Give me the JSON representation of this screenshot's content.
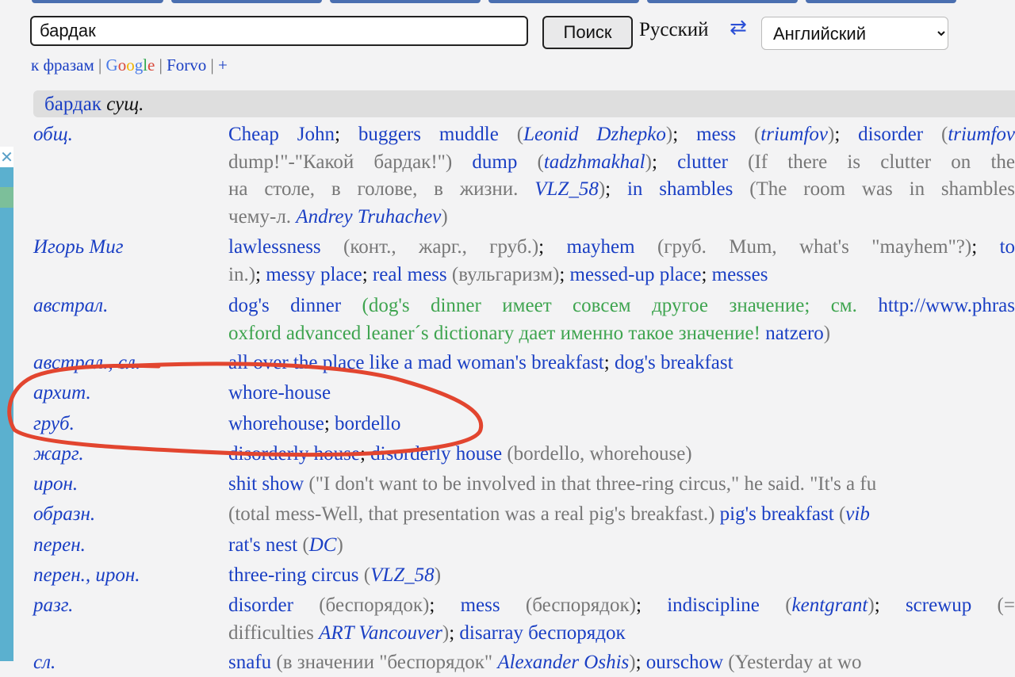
{
  "search": {
    "value": "бардак",
    "button": "Поиск"
  },
  "lang": {
    "source": "Русский",
    "swap_icon": "⇄",
    "target": "Английский",
    "swap_icon_name": "swap-arrows-icon"
  },
  "links": {
    "phrases": "к фразам",
    "google": [
      "G",
      "o",
      "o",
      "g",
      "l",
      "e"
    ],
    "forvo": "Forvo",
    "plus": "+",
    "sep": "|"
  },
  "headword": {
    "word": "бардак",
    "pos": "сущ."
  },
  "colors": {
    "link": "#1a3fc4",
    "annotation": "#e2452f",
    "muted": "#666666",
    "note_green": "#3ea44f"
  },
  "entries": [
    {
      "cat": "общ.",
      "lines": [
        [
          [
            "b",
            "Cheap John"
          ],
          [
            "k",
            "; "
          ],
          [
            "b",
            "buggers muddle"
          ],
          [
            "g",
            " ("
          ],
          [
            "bi",
            "Leonid Dzhepko"
          ],
          [
            "g",
            ")"
          ],
          [
            "k",
            "; "
          ],
          [
            "b",
            "mess"
          ],
          [
            "g",
            " ("
          ],
          [
            "bi",
            "triumfov"
          ],
          [
            "g",
            ")"
          ],
          [
            "k",
            "; "
          ],
          [
            "b",
            "disorder"
          ],
          [
            "g",
            " ("
          ],
          [
            "bi",
            "triumfov"
          ]
        ],
        [
          [
            "g",
            "dump!\"-\"Какой бардак!\")"
          ],
          [
            "k",
            " "
          ],
          [
            "b",
            "dump"
          ],
          [
            "g",
            " ("
          ],
          [
            "bi",
            "tadzhmakhal"
          ],
          [
            "g",
            ")"
          ],
          [
            "k",
            "; "
          ],
          [
            "b",
            "clutter"
          ],
          [
            "g",
            " (If there is clutter on the"
          ]
        ],
        [
          [
            "g",
            "на столе, в голове, в жизни. "
          ],
          [
            "bi",
            "VLZ_58"
          ],
          [
            "g",
            ")"
          ],
          [
            "k",
            "; "
          ],
          [
            "b",
            "in shambles"
          ],
          [
            "g",
            " (The room was in shambles"
          ]
        ],
        [
          [
            "g",
            "чему-л. "
          ],
          [
            "bi",
            "Andrey Truhachev"
          ],
          [
            "g",
            ")"
          ]
        ]
      ]
    },
    {
      "cat": "Игорь Миг",
      "lines": [
        [
          [
            "b",
            "lawlessness"
          ],
          [
            "g",
            " (конт., жарг., груб.)"
          ],
          [
            "k",
            "; "
          ],
          [
            "b",
            "mayhem"
          ],
          [
            "g",
            " (груб. Mum, what's \"mayhem\"?)"
          ],
          [
            "k",
            "; "
          ],
          [
            "b",
            "to"
          ]
        ],
        [
          [
            "g",
            "in.)"
          ],
          [
            "k",
            "; "
          ],
          [
            "b",
            "messy place"
          ],
          [
            "k",
            "; "
          ],
          [
            "b",
            "real mess"
          ],
          [
            "g",
            " (вульгаризм)"
          ],
          [
            "k",
            "; "
          ],
          [
            "b",
            "messed-up place"
          ],
          [
            "k",
            "; "
          ],
          [
            "b",
            "messes"
          ]
        ]
      ]
    },
    {
      "cat": "австрал.",
      "lines": [
        [
          [
            "b",
            "dog's dinner"
          ],
          [
            "gr",
            " (dog's dinner имеет совсем другое значение; см. "
          ],
          [
            "b",
            "http://www.phras"
          ]
        ],
        [
          [
            "gr",
            "oxford advanced leaner´s dictionary дает именно такое значение! "
          ],
          [
            "b",
            "natzero"
          ],
          [
            "g",
            ")"
          ]
        ]
      ]
    },
    {
      "cat": "австрал., сл.",
      "lines": [
        [
          [
            "b",
            "all over the place like a mad woman's breakfast"
          ],
          [
            "k",
            "; "
          ],
          [
            "b",
            "dog's breakfast"
          ]
        ]
      ]
    },
    {
      "cat": "архит.",
      "lines": [
        [
          [
            "b",
            "whore-house"
          ]
        ]
      ]
    },
    {
      "cat": "груб.",
      "lines": [
        [
          [
            "b",
            "whorehouse"
          ],
          [
            "k",
            "; "
          ],
          [
            "b",
            "bordello"
          ]
        ]
      ]
    },
    {
      "cat": "жарг.",
      "lines": [
        [
          [
            "b",
            "disorderly house"
          ],
          [
            "k",
            "; "
          ],
          [
            "b",
            "disorderly house"
          ],
          [
            "g",
            " (bordello, whorehouse)"
          ]
        ]
      ]
    },
    {
      "cat": "ирон.",
      "lines": [
        [
          [
            "b",
            "shit show"
          ],
          [
            "g",
            " (\"I don't want to be involved in that three-ring circus,\" he said. \"It's a fu"
          ]
        ]
      ]
    },
    {
      "cat": "образн.",
      "lines": [
        [
          [
            "g",
            "(total mess-Well, that presentation was a real pig's breakfast.)"
          ],
          [
            "k",
            " "
          ],
          [
            "b",
            "pig's breakfast"
          ],
          [
            "g",
            " ("
          ],
          [
            "bi",
            "vib"
          ]
        ]
      ]
    },
    {
      "cat": "перен.",
      "lines": [
        [
          [
            "b",
            "rat's nest"
          ],
          [
            "g",
            " ("
          ],
          [
            "bi",
            "DC"
          ],
          [
            "g",
            ")"
          ]
        ]
      ]
    },
    {
      "cat": "перен., ирон.",
      "lines": [
        [
          [
            "b",
            "three-ring circus"
          ],
          [
            "g",
            " ("
          ],
          [
            "bi",
            "VLZ_58"
          ],
          [
            "g",
            ")"
          ]
        ]
      ]
    },
    {
      "cat": "разг.",
      "lines": [
        [
          [
            "b",
            "disorder"
          ],
          [
            "g",
            " (беспорядок)"
          ],
          [
            "k",
            "; "
          ],
          [
            "b",
            "mess"
          ],
          [
            "g",
            " (беспорядок)"
          ],
          [
            "k",
            "; "
          ],
          [
            "b",
            "indiscipline"
          ],
          [
            "g",
            " ("
          ],
          [
            "bi",
            "kentgrant"
          ],
          [
            "g",
            ")"
          ],
          [
            "k",
            "; "
          ],
          [
            "b",
            "screwup"
          ],
          [
            "g",
            " (="
          ]
        ],
        [
          [
            "g",
            "difficulties "
          ],
          [
            "bi",
            "ART Vancouver"
          ],
          [
            "g",
            ")"
          ],
          [
            "k",
            "; "
          ],
          [
            "b",
            "disarray беспорядок"
          ]
        ]
      ]
    },
    {
      "cat": "сл.",
      "lines": [
        [
          [
            "b",
            "snafu"
          ],
          [
            "g",
            " (в значении \"беспорядок\" "
          ],
          [
            "bi",
            "Alexander Oshis"
          ],
          [
            "g",
            ")"
          ],
          [
            "k",
            "; "
          ],
          [
            "b",
            "ourschow"
          ],
          [
            "g",
            " (Yesterday at wo"
          ]
        ]
      ]
    }
  ]
}
